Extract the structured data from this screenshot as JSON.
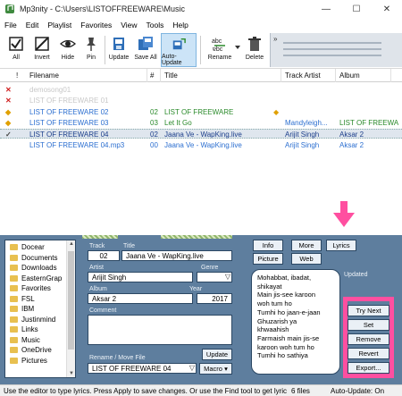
{
  "window": {
    "title": "Mp3nity - C:\\Users\\LISTOFFREEWARE\\Music",
    "minimize": "—",
    "maximize": "☐",
    "close": "✕"
  },
  "menu": [
    "File",
    "Edit",
    "Playlist",
    "Favorites",
    "View",
    "Tools",
    "Help"
  ],
  "toolbar": {
    "all": "All",
    "invert": "Invert",
    "hide": "Hide",
    "pin": "Pin",
    "update": "Update",
    "save_all": "Save All",
    "auto_update": "Auto-Update",
    "rename": "Rename",
    "delete": "Delete",
    "more": "»"
  },
  "table": {
    "headers": {
      "excl": "!",
      "filename": "Filename",
      "hash": "#",
      "title": "Title",
      "track_artist": "Track Artist",
      "album": "Album"
    },
    "rows": [
      {
        "marker": "✕",
        "marker_color": "#d02020",
        "filename": "demosong01",
        "num": "",
        "title": "",
        "artist": "",
        "album": "",
        "color": "#c8c8c8",
        "flag": ""
      },
      {
        "marker": "✕",
        "marker_color": "#d02020",
        "filename": "LIST OF FREEWARE 01",
        "num": "",
        "title": "",
        "artist": "",
        "album": "",
        "color": "#c8c8c8",
        "flag": ""
      },
      {
        "marker": "◆",
        "marker_color": "#e0a000",
        "filename": "LIST OF FREEWARE 02",
        "num": "02",
        "title": "LIST OF FREEWARE",
        "artist": "",
        "album": "",
        "color": "#2c6fd0",
        "flag": "◆",
        "alt_color": "#2a8a2a"
      },
      {
        "marker": "◆",
        "marker_color": "#e0a000",
        "filename": "LIST OF FREEWARE 03",
        "num": "03",
        "title": "Let It Go",
        "artist": "Mandyleigh...",
        "album": "LIST OF FREEWA",
        "color": "#2c6fd0",
        "flag": "",
        "alt_color": "#2a8a2a"
      },
      {
        "marker": "✓",
        "marker_color": "#444",
        "filename": "LIST OF FREEWARE 04",
        "num": "02",
        "title": "Jaana Ve - WapKing.live",
        "artist": "Arijit Singh",
        "album": "Aksar 2",
        "color": "#1a3d8a",
        "flag": "",
        "selected": true
      },
      {
        "marker": "",
        "marker_color": "#444",
        "filename": "LIST OF FREEWARE 04.mp3",
        "num": "00",
        "title": "Jaana Ve - WapKing.live",
        "artist": "Arijit Singh",
        "album": "Aksar 2",
        "color": "#2c6fd0",
        "flag": ""
      }
    ]
  },
  "folders": [
    "Docear",
    "Documents",
    "Downloads",
    "EasternGrap",
    "Favorites",
    "FSL",
    "IBM",
    "Justinmind",
    "Links",
    "Music",
    "OneDrive",
    "Pictures"
  ],
  "editor": {
    "track_label": "Track",
    "title_label": "Title",
    "track": "02",
    "title": "Jaana Ve - WapKing.live",
    "artist_label": "Artist",
    "genre_label": "Genre",
    "artist": "Arijit Singh",
    "genre": "",
    "album_label": "Album",
    "year_label": "Year",
    "album": "Aksar 2",
    "year": "2017",
    "comment_label": "Comment",
    "comment": "",
    "update": "Update",
    "rename_label": "Rename / Move File",
    "rename_value": "LIST OF FREEWARE 04",
    "macro": "Macro"
  },
  "lyrics": {
    "tabs": [
      "Info",
      "More",
      "Lyrics",
      "Picture",
      "Web"
    ],
    "status": "Updated",
    "lines": [
      "Mohabbat, ibadat,",
      "shikayat",
      "Main jis-see karoon",
      "woh tum ho",
      "Tumhi ho jaan-e-jaan",
      "Ghuzarish ya",
      "khwaahish",
      "Farmaish main jis-se",
      "karoon woh tum ho",
      "Tumhi ho sathiya"
    ],
    "buttons": [
      "Try Next",
      "Set",
      "Remove",
      "Revert",
      "Export..."
    ]
  },
  "status": {
    "help": "Use the editor to type lyrics. Press Apply to save changes. Or use the Find tool to get lyric",
    "files": "6 files",
    "auto_update": "Auto-Update: On"
  },
  "colors": {
    "panel": "#5e7e9e",
    "highlight": "#ff4fa0",
    "link": "#2c6fd0"
  }
}
